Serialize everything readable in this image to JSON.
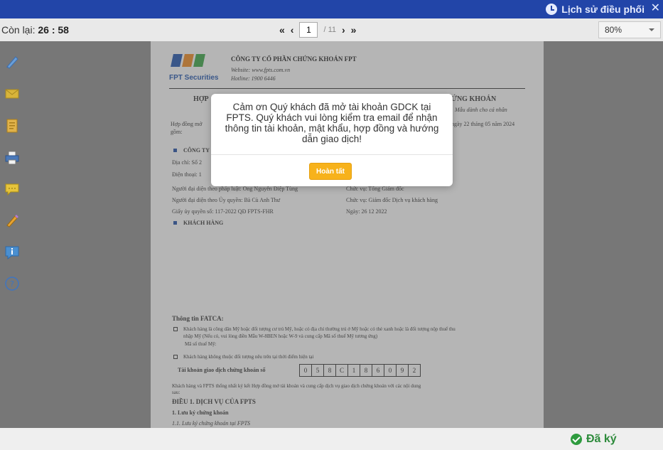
{
  "header": {
    "history_label": "Lịch sử điều phối",
    "close_symbol": "✕"
  },
  "toolbar": {
    "remaining_label": "Còn lại:",
    "remaining_time": "26 : 58",
    "first_symbol": "«",
    "prev_symbol": "‹",
    "next_symbol": "›",
    "last_symbol": "»",
    "current_page": "1",
    "total_pages": "/ 11",
    "zoom": "80%"
  },
  "document": {
    "brand": "FPT Securities",
    "company": "CÔNG TY CỔ PHẦN CHỨNG KHOÁN FPT",
    "website": "Website: www.fpts.com.vn",
    "hotline": "Hotline: 1900 6446",
    "title_left": "HỢP",
    "title_right": "ỨNG KHOÁN",
    "subtitle": "Mẫu dành cho cá nhân",
    "intro_left": "Hợp đồng mở",
    "intro_right": "o ngày 22 tháng 05 năm 2024",
    "intro_line2": "gồm:",
    "section_a": "CÔNG TY",
    "address": "Địa chỉ: Số 2",
    "phone": "Điện thoại: 1",
    "rep_label": "Người đại diện theo pháp luật: Ông Nguyễn Điệp Tùng",
    "rep_position": "Chức vụ: Tổng Giám đốc",
    "auth_label": "Người đại diện theo Ủy quyền: Bà Cù Anh Thư",
    "auth_position": "Chức vụ: Giám đốc Dịch vụ khách hàng",
    "auth_doc": "Giấy ủy quyền số: 117-2022 QĐ FPTS-FHR",
    "auth_date": "Ngày: 26 12 2022",
    "section_b": "KHÁCH HÀNG",
    "fatca_title": "Thông tin FATCA:",
    "fatca_1": "Khách hàng là công dân Mỹ hoặc đối tượng cư trú Mỹ, hoặc có địa chỉ thường trú ở Mỹ hoặc có thẻ xanh hoặc là đối tượng nộp thuế thu",
    "fatca_1b": "nhập Mỹ (Nếu có, vui lòng điền Mẫu W-8BEN hoặc W-9 và cung cấp Mã số thuế Mỹ tương ứng)",
    "fatca_tax": "Mã số thuế Mỹ:",
    "fatca_2": "Khách hàng không thuộc đối tượng nêu trên tại thời điểm hiện tại",
    "account_label": "Tài khoản giao dịch chứng khoán số",
    "account_digits": [
      "0",
      "5",
      "8",
      "C",
      "1",
      "8",
      "6",
      "0",
      "9",
      "2"
    ],
    "agreement_1": "Khách hàng và FPTS thống nhất ký kết Hợp đồng mở tài khoản và cung cấp dịch vụ giao dịch chứng khoán với các nội dung",
    "agreement_2": "sau:",
    "article_1": "ĐIỀU 1. DỊCH VỤ CỦA FPTS",
    "item_1": "1.   Lưu ký chứng khoán",
    "item_1_1": "1.1.   Lưu ký chứng khoán tại FPTS"
  },
  "modal": {
    "message": "Cảm ơn Quý khách đã mở tài khoản GDCK tại FPTS. Quý khách vui lòng kiểm tra email để nhận thông tin tài khoản, mật khẩu, hợp đồng và hướng dẫn giao dịch!",
    "button_label": "Hoàn tất"
  },
  "footer": {
    "signed_label": "Đã ký"
  },
  "colors": {
    "topbar": "#2245a8",
    "button": "#f7b21b",
    "signed": "#2e8b3c",
    "fpt_blue": "#1f55b0",
    "fpt_orange": "#f28a20",
    "fpt_green": "#3aa846"
  }
}
